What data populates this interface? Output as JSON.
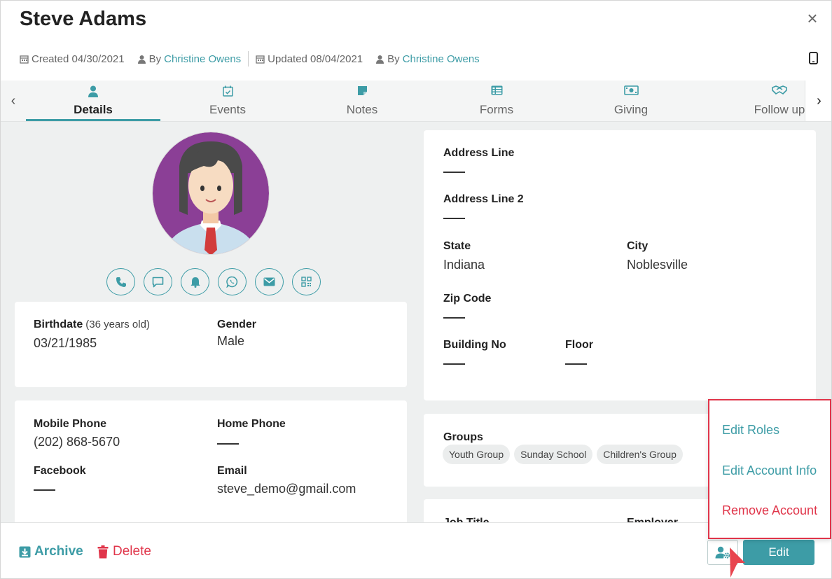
{
  "header": {
    "title": "Steve Adams",
    "close_symbol": "×",
    "created_label": "Created 04/30/2021",
    "by_prefix": "By",
    "created_by": "Christine Owens",
    "updated_label": "Updated 08/04/2021",
    "updated_by": "Christine Owens"
  },
  "tabs": [
    {
      "label": "Details",
      "icon": "person-icon",
      "active": true
    },
    {
      "label": "Events",
      "icon": "calendar-check-icon"
    },
    {
      "label": "Notes",
      "icon": "note-icon"
    },
    {
      "label": "Forms",
      "icon": "list-icon"
    },
    {
      "label": "Giving",
      "icon": "money-icon"
    },
    {
      "label": "Follow up",
      "icon": "handshake-icon"
    }
  ],
  "actions": [
    "phone-icon",
    "chat-icon",
    "bell-icon",
    "whatsapp-icon",
    "envelope-icon",
    "qr-code-icon"
  ],
  "personal": {
    "birthdate_label": "Birthdate",
    "age_note": "(36 years old)",
    "birthdate": "03/21/1985",
    "gender_label": "Gender",
    "gender": "Male"
  },
  "contact": {
    "mobile_label": "Mobile Phone",
    "mobile": "(202) 868-5670",
    "home_label": "Home Phone",
    "facebook_label": "Facebook",
    "email_label": "Email",
    "email": "steve_demo@gmail.com"
  },
  "address": {
    "line1_label": "Address Line",
    "line2_label": "Address Line 2",
    "state_label": "State",
    "state": "Indiana",
    "city_label": "City",
    "city": "Noblesville",
    "zip_label": "Zip Code",
    "building_label": "Building No",
    "floor_label": "Floor"
  },
  "groups": {
    "label": "Groups",
    "items": [
      "Youth Group",
      "Sunday School",
      "Children's Group"
    ]
  },
  "job": {
    "title_label": "Job Title",
    "employer_label": "Employer"
  },
  "footer": {
    "archive_label": "Archive",
    "delete_label": "Delete",
    "edit_label": "Edit"
  },
  "account_menu": {
    "items": [
      "Edit Roles",
      "Edit Account Info",
      "Remove Account"
    ]
  },
  "colors": {
    "accent": "#3d9ca6",
    "danger": "#e0354a",
    "avatar_bg": "#8b3f96"
  }
}
